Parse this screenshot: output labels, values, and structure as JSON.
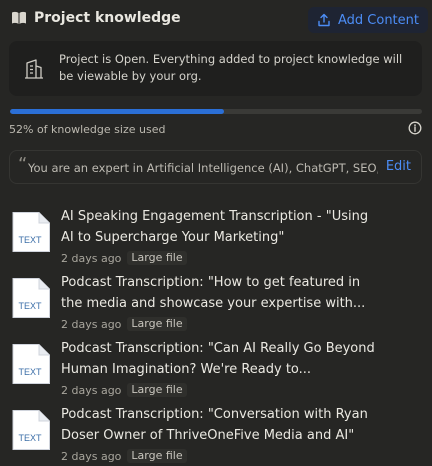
{
  "header": {
    "title": "Project knowledge",
    "add_button_label": "Add Content",
    "icon": "book-icon"
  },
  "notice": {
    "text": "Project is Open. Everything added to project knowledge will be viewable by your org.",
    "icon": "building-icon"
  },
  "usage": {
    "percent": 52,
    "label": "52% of knowledge size used"
  },
  "instructions": {
    "text": "You are an expert in Artificial Intelligence (AI), ChatGPT, SEO,...",
    "edit_label": "Edit"
  },
  "files": [
    {
      "title": "AI Speaking Engagement Transcription - \"Using AI to Supercharge Your Marketing\"",
      "date": "2 days ago",
      "badge": "Large file",
      "icon_label": "TEXT"
    },
    {
      "title": "Podcast Transcription: \"How to get featured in the media and showcase your expertise with...",
      "date": "2 days ago",
      "badge": "Large file",
      "icon_label": "TEXT"
    },
    {
      "title": "Podcast Transcription: \"Can AI Really Go Beyond Human Imagination? We're Ready to...",
      "date": "2 days ago",
      "badge": "Large file",
      "icon_label": "TEXT"
    },
    {
      "title": "Podcast Transcription: \"Conversation with Ryan Doser Owner of ThriveOneFive Media and AI\"",
      "date": "2 days ago",
      "badge": "Large file",
      "icon_label": "TEXT"
    }
  ],
  "colors": {
    "background": "#262624",
    "accent": "#4c8df6",
    "progress": "#2b6fd6"
  }
}
